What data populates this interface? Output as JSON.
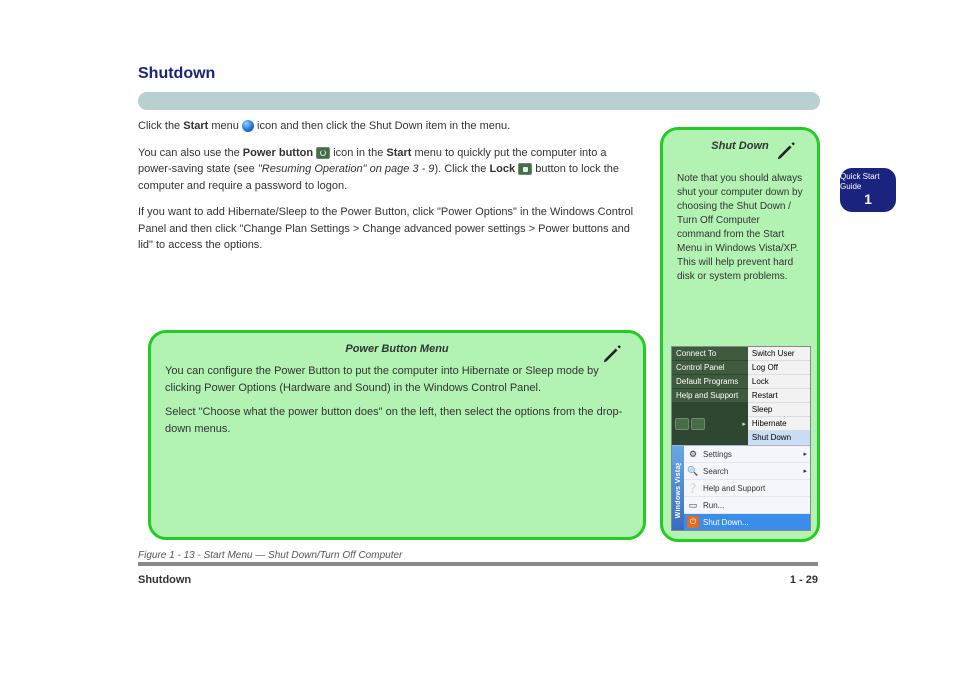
{
  "header": {
    "section_title": "Shutdown"
  },
  "body": {
    "p1_a": "Click the ",
    "p1_b": " menu ",
    "p1_c": " icon and then click the Shut Down item in the menu.",
    "p2_a": " You can also use the ",
    "p2_b": "Power button ",
    "p2_c": " icon in the ",
    "p2_d": " menu to quickly put the computer into a power-saving state (see ",
    "p2_link": "\"Resuming Operation\" on page 3 - 9",
    "p2_e": "). Click the ",
    "p2_f": "Lock ",
    "p2_g": " button to lock the computer and require a password to logon.",
    "p3": "If you want to add Hibernate/Sleep to the Power Button, click \"Power Options\" in the Windows Control Panel and then click \"Change Plan Settings > Change advanced power settings > Power buttons and lid\" to access the options.",
    "start": "Start"
  },
  "panel_left": {
    "title": "Power Button Menu",
    "p1": "You can configure the Power Button to put the computer into Hibernate or Sleep mode by clicking Power Options (Hardware and Sound) in the Windows Control Panel.",
    "p2": "Select \"Choose what the power button does\" on the left, then select the options from the drop-down menus."
  },
  "panel_right": {
    "title": "Shut Down",
    "p1": "Note that you should always shut your computer down by choosing the Shut Down / Turn Off Computer command from the Start Menu in Windows Vista/XP. This will help prevent hard disk or system problems."
  },
  "vista_menu": {
    "left": [
      "Connect To",
      "Control Panel",
      "Default Programs",
      "Help and Support"
    ],
    "right": [
      "Switch User",
      "Log Off",
      "Lock",
      "Restart",
      "Sleep",
      "Hibernate",
      "Shut Down"
    ]
  },
  "xp_menu": {
    "strip": "Windows Vista™",
    "items": [
      "Settings",
      "Search",
      "Help and Support",
      "Run..."
    ],
    "shutdown": "Shut Down..."
  },
  "figure": {
    "caption": "Figure 1 - 13 - Start Menu — Shut Down/Turn Off Computer"
  },
  "footer": {
    "left": "Shutdown",
    "right": "1 - 29"
  },
  "page_tab": {
    "label": "Quick Start Guide",
    "num": "1"
  }
}
